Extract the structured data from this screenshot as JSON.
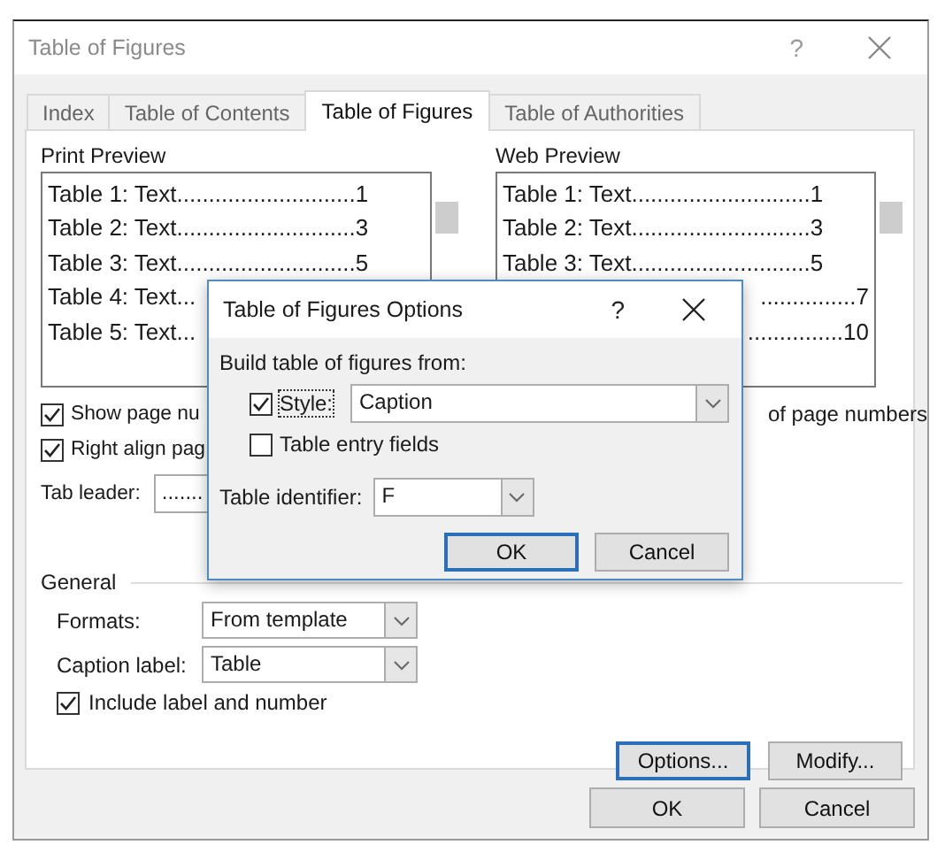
{
  "dialog": {
    "title": "Table of Figures",
    "help": "?"
  },
  "tabs": [
    {
      "label": "Index",
      "selected": false
    },
    {
      "label": "Table of Contents",
      "selected": false
    },
    {
      "label": "Table of Figures",
      "selected": true
    },
    {
      "label": "Table of Authorities",
      "selected": false
    }
  ],
  "print_preview": {
    "label": "Print Preview",
    "rows": [
      "Table 1: Text............................1",
      "Table 2: Text............................3",
      "Table 3: Text............................5",
      "Table 4: Text...",
      "Table 5: Text..."
    ]
  },
  "web_preview": {
    "label": "Web Preview",
    "rows": [
      {
        "kind": "full",
        "text": "Table 1: Text............................1"
      },
      {
        "kind": "full",
        "text": "Table 2: Text............................3"
      },
      {
        "kind": "full",
        "text": "Table 3: Text............................5"
      },
      {
        "kind": "tail",
        "text": "...............7"
      },
      {
        "kind": "tail",
        "text": "...............10"
      }
    ]
  },
  "print_options": [
    {
      "label": "Show page nu",
      "checked": true
    },
    {
      "label": "Right align pag",
      "checked": true
    }
  ],
  "tab_leader": {
    "label": "Tab leader:",
    "value": "......."
  },
  "web_option": {
    "label": "of page numbers"
  },
  "general": {
    "title": "General",
    "formats": {
      "label": "Formats:",
      "value": "From template"
    },
    "caption_label": {
      "label": "Caption label:",
      "value": "Table"
    },
    "include": {
      "label": "Include label and number",
      "checked": true
    }
  },
  "panel_buttons": [
    {
      "label": "Options...",
      "default": true
    },
    {
      "label": "Modify...",
      "default": false
    }
  ],
  "footer_buttons": [
    {
      "label": "OK",
      "default": false
    },
    {
      "label": "Cancel",
      "default": false
    }
  ],
  "options_dialog": {
    "title": "Table of Figures Options",
    "help": "?",
    "group": "Build table of figures from:",
    "style": {
      "label": "Style:",
      "checked": true,
      "value": "Caption"
    },
    "entry_fields": {
      "label": "Table entry fields",
      "checked": false
    },
    "identifier": {
      "label": "Table identifier:",
      "value": "F"
    },
    "buttons": [
      {
        "label": "OK",
        "default": true
      },
      {
        "label": "Cancel",
        "default": false
      }
    ]
  }
}
